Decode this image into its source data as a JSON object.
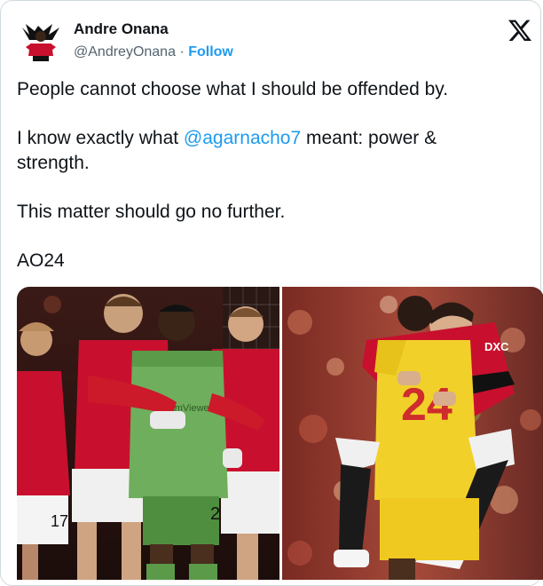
{
  "author": {
    "display_name": "Andre Onana",
    "handle": "@AndreyOnana",
    "separator": "·",
    "follow_label": "Follow"
  },
  "tweet": {
    "line1": "People cannot choose what I should be offended by.",
    "line2_pre": "I know exactly what ",
    "line2_mention": "@agarnacho7",
    "line2_post": " meant: power & strength.",
    "line3": "This matter should go no further.",
    "line4": "AO24"
  },
  "media": {
    "left_photo": {
      "sponsor_text": "Team\nViewer",
      "jersey_number": "2",
      "jersey_number_alt": "17"
    },
    "right_photo": {
      "jersey_number": "24",
      "sponsor_text": "DXC"
    }
  },
  "colors": {
    "accent": "#1d9bf0",
    "text": "#0f1419",
    "secondary": "#536471",
    "united_red": "#c8102e",
    "gk_green": "#6fae5c",
    "gk_yellow": "#f2d02a"
  },
  "icons": {
    "brand": "x-logo-icon",
    "avatar": "avatar"
  }
}
